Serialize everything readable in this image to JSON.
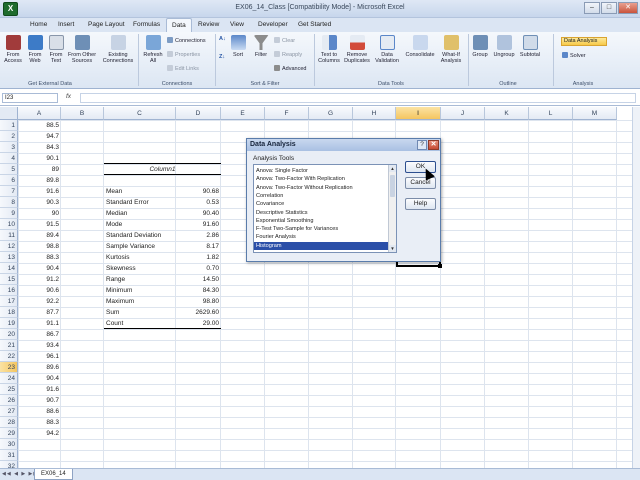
{
  "window": {
    "title": "EX06_14_Class  [Compatibility Mode] - Microsoft Excel"
  },
  "tabs": [
    "Home",
    "Insert",
    "Page Layout",
    "Formulas",
    "Data",
    "Review",
    "View",
    "Developer",
    "Get Started"
  ],
  "ribbon": {
    "buttons": [
      "From Access",
      "From Web",
      "From Text",
      "From Other Sources",
      "Existing Connections",
      "Refresh All",
      "Connections",
      "Properties",
      "Edit Links",
      "Sort",
      "Filter",
      "Clear",
      "Reapply",
      "Advanced",
      "Text to Columns",
      "Remove Duplicates",
      "Data Validation",
      "Consolidate",
      "What-If Analysis",
      "Group",
      "Ungroup",
      "Subtotal",
      "Data Analysis",
      "Solver"
    ],
    "groups": [
      "Get External Data",
      "Connections",
      "Sort & Filter",
      "Data Tools",
      "Outline",
      "Analysis"
    ]
  },
  "formula_bar": {
    "name_box": "I23",
    "fx": "fx"
  },
  "columns": [
    "A",
    "B",
    "C",
    "D",
    "E",
    "F",
    "G",
    "H",
    "I",
    "J",
    "K",
    "L",
    "M"
  ],
  "selected_column": "I",
  "selected_row": 23,
  "rows": [
    "1",
    "2",
    "3",
    "4",
    "5",
    "6",
    "7",
    "8",
    "9",
    "10",
    "11",
    "12",
    "13",
    "14",
    "15",
    "16",
    "17",
    "18",
    "19",
    "20",
    "21",
    "22",
    "23",
    "24",
    "25",
    "26",
    "27",
    "28",
    "29",
    "30",
    "31",
    "32"
  ],
  "column_a": [
    "88.5",
    "94.7",
    "84.3",
    "90.1",
    "89",
    "89.8",
    "91.6",
    "90.3",
    "90",
    "91.5",
    "89.4",
    "98.8",
    "88.3",
    "90.4",
    "91.2",
    "90.6",
    "92.2",
    "87.7",
    "91.1",
    "86.7",
    "93.4",
    "96.1",
    "89.6",
    "90.4",
    "91.6",
    "90.7",
    "88.6",
    "88.3",
    "94.2"
  ],
  "stats_header": "Column1",
  "stats_labels": [
    "Mean",
    "Standard Error",
    "Median",
    "Mode",
    "Standard Deviation",
    "Sample Variance",
    "Kurtosis",
    "Skewness",
    "Range",
    "Minimum",
    "Maximum",
    "Sum",
    "Count"
  ],
  "stats_values": [
    "90.68",
    "0.53",
    "90.40",
    "91.60",
    "2.86",
    "8.17",
    "1.82",
    "0.70",
    "14.50",
    "84.30",
    "98.80",
    "2629.60",
    "29.00"
  ],
  "sheet": {
    "tab": "EX06_14"
  },
  "dialog": {
    "title": "Data Analysis",
    "label": "Analysis Tools",
    "items": [
      "Anova: Single Factor",
      "Anova: Two-Factor With Replication",
      "Anova: Two-Factor Without Replication",
      "Correlation",
      "Covariance",
      "Descriptive Statistics",
      "Exponential Smoothing",
      "F-Test Two-Sample for Variances",
      "Fourier Analysis",
      "Histogram"
    ],
    "selected": "Histogram",
    "ok": "OK",
    "cancel": "Cancel",
    "help": "Help"
  }
}
